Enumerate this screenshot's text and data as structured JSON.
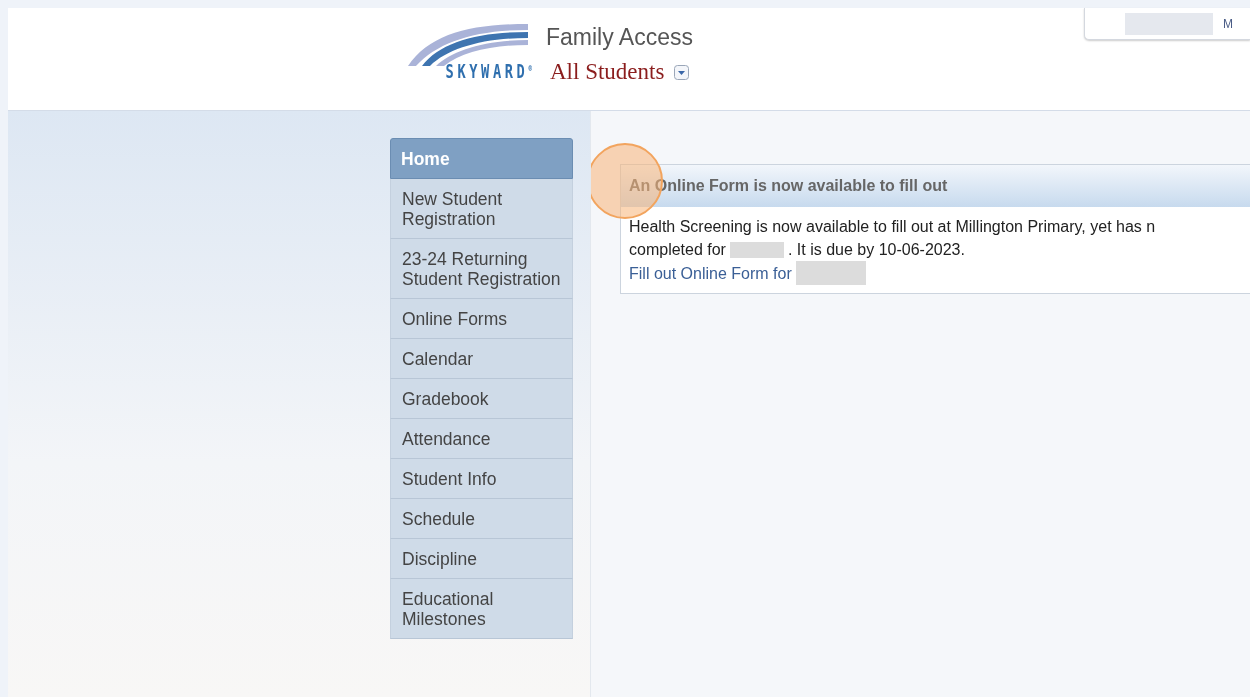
{
  "header": {
    "logo_text": "SKYWARD",
    "logo_mark": "®",
    "product": "Family Access",
    "student_picker": "All Students",
    "account_menu": "M"
  },
  "sidebar": {
    "items": [
      {
        "label": "Home",
        "selected": true
      },
      {
        "label": "New Student Registration",
        "selected": false
      },
      {
        "label": "23-24 Returning Student Registration",
        "selected": false
      },
      {
        "label": "Online Forms",
        "selected": false
      },
      {
        "label": "Calendar",
        "selected": false
      },
      {
        "label": "Gradebook",
        "selected": false
      },
      {
        "label": "Attendance",
        "selected": false
      },
      {
        "label": "Student Info",
        "selected": false
      },
      {
        "label": "Schedule",
        "selected": false
      },
      {
        "label": "Discipline",
        "selected": false
      },
      {
        "label": "Educational Milestones",
        "selected": false
      }
    ]
  },
  "message": {
    "title": "An Online Form is now available to fill out",
    "line_1": "Health Screening is now available to fill out at Millington Primary, yet has n",
    "line_2_start": "completed for",
    "line_2_end": ". It is due by 10-06-2023.",
    "link": "Fill out Online Form for"
  },
  "click_highlight": {
    "shown": true
  }
}
